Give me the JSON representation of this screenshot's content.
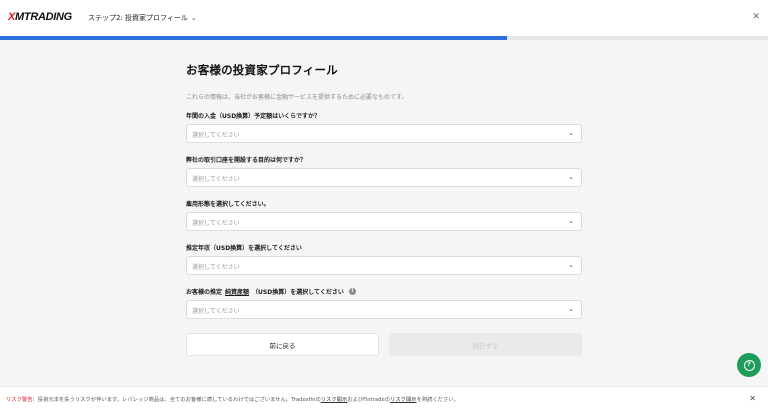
{
  "header": {
    "logo_prefix": "X",
    "logo_rest": "MTRADING",
    "step_label": "ステップ2: 投資家プロフィール",
    "close_icon": "close-icon"
  },
  "progress": {
    "fraction": 0.66,
    "color": "#2a6fdb"
  },
  "form": {
    "title": "お客様の投資家プロフィール",
    "description": "これらの情報は、当社がお客様に金融サービスを提供するために必要なものです。",
    "questions": [
      {
        "label": "年間の入金（USD換算）予定額はいくらですか？",
        "placeholder": "選択してください"
      },
      {
        "label": "弊社の取引口座を開設する目的は何ですか？",
        "placeholder": "選択してください"
      },
      {
        "label": "雇用形態を選択してください。",
        "placeholder": "選択してください"
      },
      {
        "label": "推定年収（USD換算）を選択してください",
        "placeholder": "選択してください"
      },
      {
        "label_pre": "お客様の推定",
        "label_link": "純資産額",
        "label_post": "（USD換算）を選択してください",
        "placeholder": "選択してください"
      }
    ],
    "back_label": "前に戻る",
    "next_label": "続行する"
  },
  "risk": {
    "label": "リスク警告：",
    "text_1": "投資元本を失うリスクが伴います。レバレッジ商品は、全てのお客様に適しているわけではございません。Tradexfinの",
    "link_1": "リスク開示",
    "text_2": "およびFintradeの",
    "link_2": "リスク開示",
    "text_3": "を熟読ください。"
  },
  "colors": {
    "brand_red": "#d51820",
    "accent_blue": "#2a6fdb",
    "chat_green": "#1e9d5a"
  }
}
